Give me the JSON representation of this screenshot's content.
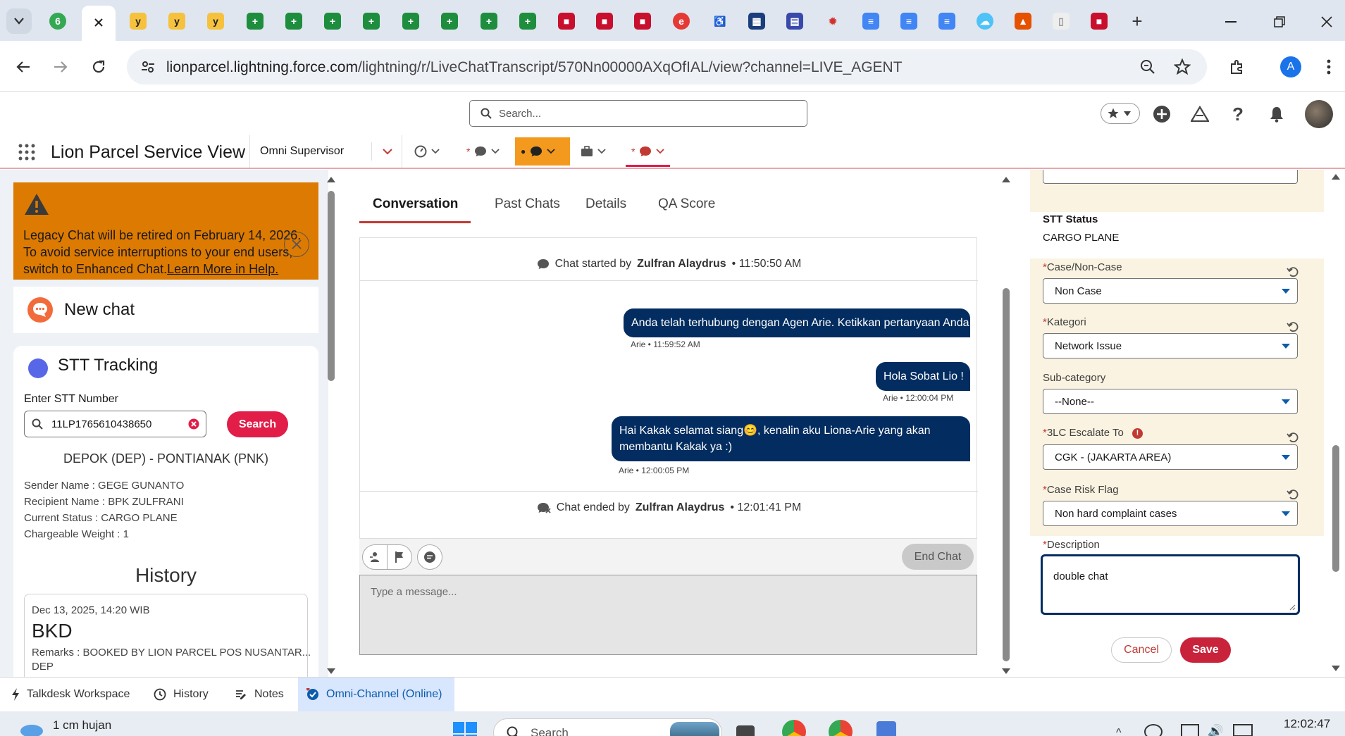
{
  "browser": {
    "tab_badge_count": "6",
    "address": {
      "domain": "lionparcel.lightning.force.com",
      "path": "/lightning/r/LiveChatTranscript/570Nn00000AXqOfIAL/view?channel=LIVE_AGENT"
    },
    "profile_initial": "A"
  },
  "global_header": {
    "search_placeholder": "Search..."
  },
  "app_nav": {
    "app_name": "Lion Parcel Service View",
    "nav_selector": "Omni Supervisor",
    "required_marker": "*"
  },
  "left_panel": {
    "banner": {
      "text": "Legacy Chat will be retired on February 14, 2026. To avoid service interruptions to your end users, switch to Enhanced Chat.",
      "link": "Learn More in Help."
    },
    "new_chat_title": "New chat",
    "stt": {
      "title": "STT Tracking",
      "input_label": "Enter STT Number",
      "input_value": "11LP1765610438650",
      "search_button": "Search",
      "route": "DEPOK (DEP) - PONTIANAK (PNK)",
      "sender": "Sender Name : GEGE GUNANTO",
      "recipient": "Recipient Name : BPK ZULFRANI",
      "status": "Current Status : CARGO PLANE",
      "weight": "Chargeable Weight : 1"
    },
    "history": {
      "title": "History",
      "date": "Dec 13, 2025, 14:20 WIB",
      "code": "BKD",
      "remarks": "Remarks : BOOKED BY LION PARCEL POS NUSANTAR...",
      "remarks_cont": "DEP"
    }
  },
  "chat": {
    "tabs": [
      "Conversation",
      "Past Chats",
      "Details",
      "QA Score"
    ],
    "started": {
      "prefix": "Chat started by",
      "name": "Zulfran Alaydrus",
      "time": "• 11:50:50 AM"
    },
    "messages": [
      {
        "text": "Anda telah terhubung dengan Agen Arie. Ketikkan pertanyaan Anda",
        "meta": "Arie • 11:59:52 AM"
      },
      {
        "text": "Hola Sobat Lio !",
        "meta": "Arie • 12:00:04 PM"
      },
      {
        "text": "Hai Kakak selamat siang😊, kenalin aku Liona-Arie yang akan membantu Kakak ya :)",
        "meta": "Arie • 12:00:05 PM"
      }
    ],
    "ended": {
      "prefix": "Chat ended by",
      "name": "Zulfran Alaydrus",
      "time": "• 12:01:41 PM"
    },
    "end_chat_button": "End Chat",
    "input_placeholder": "Type a message..."
  },
  "right_panel": {
    "stt_status_label": "STT Status",
    "stt_status_value": "CARGO PLANE",
    "case_type": {
      "label": "Case/Non-Case",
      "value": "Non Case"
    },
    "category": {
      "label": "Kategori",
      "value": "Network Issue"
    },
    "subcategory": {
      "label": "Sub-category",
      "value": "--None--"
    },
    "escalate": {
      "label": "3LC Escalate To",
      "value": "CGK - (JAKARTA AREA)"
    },
    "risk_flag": {
      "label": "Case Risk Flag",
      "value": "Non hard complaint cases"
    },
    "description": {
      "label": "Description",
      "value": "double chat"
    },
    "required_marker": "*",
    "cancel_button": "Cancel",
    "save_button": "Save"
  },
  "utility_bar": {
    "items": [
      "Talkdesk Workspace",
      "History",
      "Notes",
      "Omni-Channel (Online)"
    ]
  },
  "taskbar": {
    "weather": "1 cm hujan",
    "search": "Search",
    "clock": "12:02:47"
  },
  "colors": {
    "brand_red": "#e11d48",
    "banner_orange": "#dd7a01",
    "bubble_navy": "#032d60",
    "required_red": "#c23934",
    "omni_active": "#d8e6fe"
  }
}
